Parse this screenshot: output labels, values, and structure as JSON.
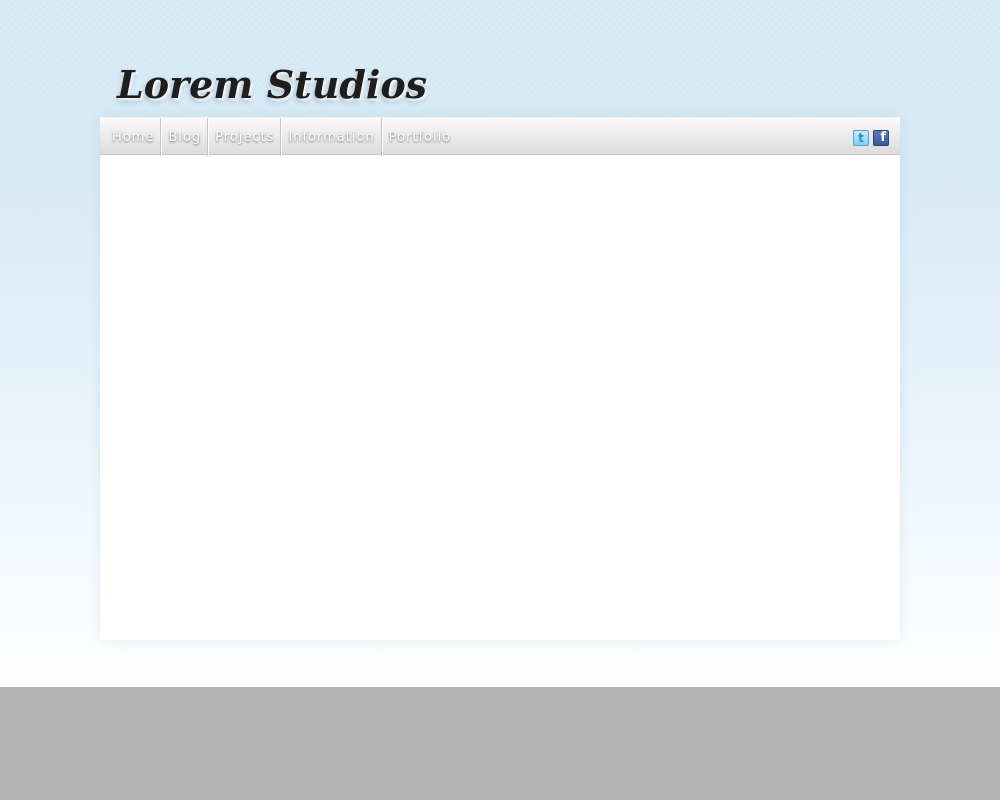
{
  "site": {
    "logo_text": "Lorem Studios"
  },
  "nav": {
    "items": [
      {
        "label": "Home"
      },
      {
        "label": "Blog"
      },
      {
        "label": "Projects"
      },
      {
        "label": "Information"
      },
      {
        "label": "Portfolio"
      }
    ]
  },
  "social": {
    "twitter_glyph": "t",
    "facebook_glyph": "f",
    "icons": [
      "twitter-icon",
      "facebook-icon"
    ]
  },
  "colors": {
    "sky_top": "#d3e8f6",
    "footer": "#b5b5b5",
    "content_bg": "#ffffff",
    "nav_text": "#ffffff"
  }
}
